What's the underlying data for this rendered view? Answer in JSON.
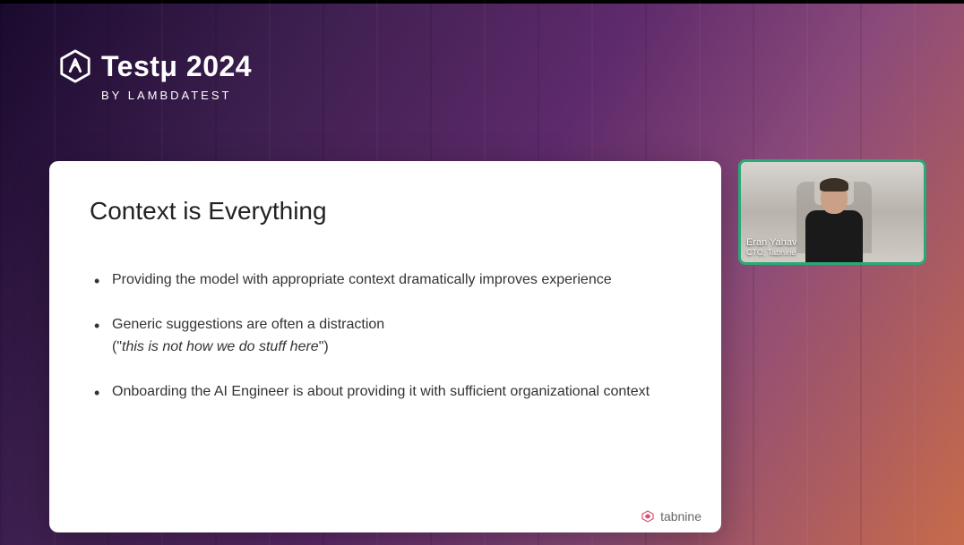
{
  "event": {
    "logo_text": "Testμ 2024",
    "subtitle": "BY LAMBDATEST"
  },
  "slide": {
    "title": "Context is Everything",
    "bullets": [
      {
        "text": "Providing the model with appropriate context dramatically improves experience"
      },
      {
        "text": "Generic suggestions are often a distraction",
        "note_prefix": "(\"",
        "note_italic": "this is not how we do stuff here",
        "note_suffix": "\")"
      },
      {
        "text": "Onboarding the AI Engineer is about providing it with sufficient organizational context"
      }
    ],
    "footer_brand": "tabnine"
  },
  "speaker": {
    "name": "Eran Yahav",
    "title": "CTO, Tabnine"
  }
}
